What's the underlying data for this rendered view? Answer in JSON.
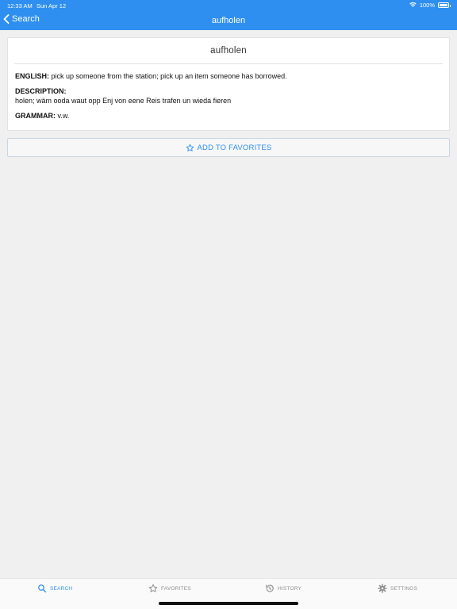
{
  "status": {
    "time": "12:33 AM",
    "date": "Sun Apr 12",
    "battery": "100%"
  },
  "nav": {
    "back_label": "Search",
    "title": "aufholen"
  },
  "entry": {
    "word": "aufholen",
    "english_label": "ENGLISH:",
    "english": "pick up someone from the station; pick up an item someone has borrowed.",
    "description_label": "DESCRIPTION:",
    "description": "holen; wäm ooda waut opp Enj von eene Reis trafen un wieda fieren",
    "grammar_label": "GRAMMAR:",
    "grammar": "v.w."
  },
  "favorites_button": {
    "label": "ADD TO FAVORITES",
    "icon": "star-outline-icon"
  },
  "tabs": [
    {
      "label": "SEARCH",
      "icon": "search-icon",
      "active": true
    },
    {
      "label": "FAVORITES",
      "icon": "star-icon",
      "active": false
    },
    {
      "label": "HISTORY",
      "icon": "history-icon",
      "active": false
    },
    {
      "label": "SETTINGS",
      "icon": "gear-icon",
      "active": false
    }
  ],
  "colors": {
    "accent": "#2e8ff0",
    "inactive": "#8e8e8e",
    "background": "#f0f0f0"
  }
}
